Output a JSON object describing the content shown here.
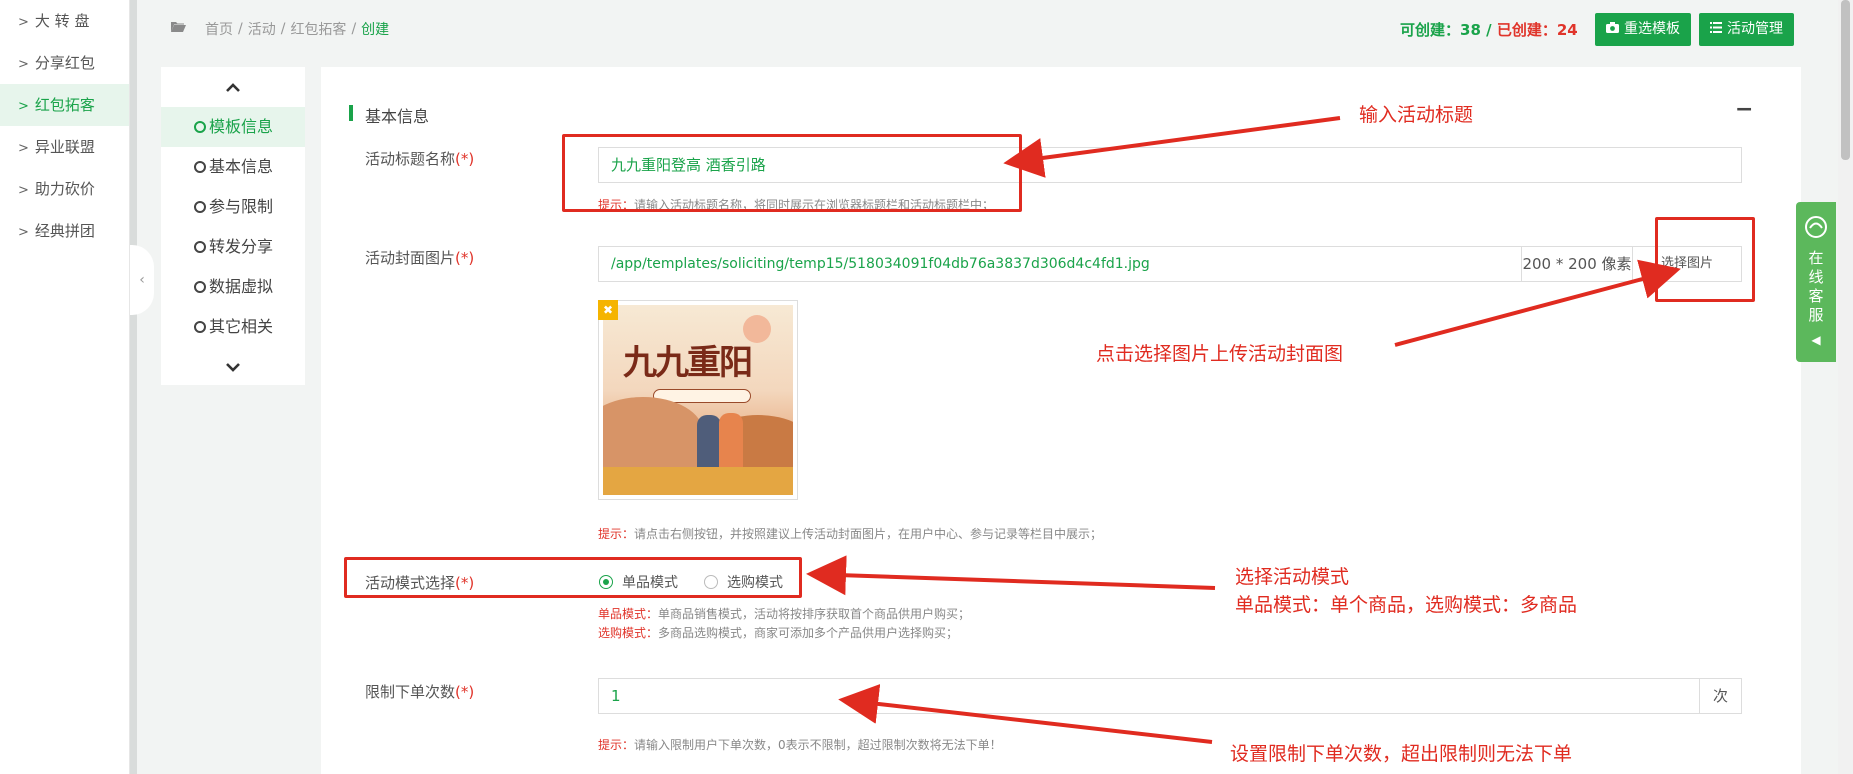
{
  "leftnav": {
    "items": [
      {
        "label": "大 转 盘",
        "active": false
      },
      {
        "label": "分享红包",
        "active": false
      },
      {
        "label": "红包拓客",
        "active": true
      },
      {
        "label": "异业联盟",
        "active": false
      },
      {
        "label": "助力砍价",
        "active": false
      },
      {
        "label": "经典拼团",
        "active": false
      }
    ],
    "chevron": ">",
    "collapse": "‹"
  },
  "breadcrumb": {
    "home": "首页",
    "sep": "/",
    "level2": "活动",
    "level3": "红包拓客",
    "current": "创建"
  },
  "counts": {
    "can_create_label": "可创建：",
    "can_create": "38",
    "slash": " / ",
    "created_label": "已创建：",
    "created": "24"
  },
  "toolbar": {
    "reselect_label": "重选模板",
    "manage_label": "活动管理"
  },
  "steps": {
    "up": "⌃",
    "down": "⌄",
    "items": [
      "模板信息",
      "基本信息",
      "参与限制",
      "转发分享",
      "数据虚拟",
      "其它相关"
    ],
    "active_index": 0
  },
  "section": {
    "title": "基本信息",
    "collapse": "−"
  },
  "form": {
    "title": {
      "label": "活动标题名称",
      "req": "(*)",
      "value": "九九重阳登高 酒香引路",
      "hint_key": "提示：",
      "hint": "请输入活动标题名称，将同时展示在浏览器标题栏和活动标题栏中；"
    },
    "cover": {
      "label": "活动封面图片",
      "req": "(*)",
      "value": "/app/templates/soliciting/temp15/518034091f04db76a3837d306d4c4fd1.jpg",
      "size_addon": "200 * 200 像素",
      "select_button": "选择图片",
      "hint_key": "提示：",
      "hint": "请点击右侧按钮，并按照建议上传活动封面图片，在用户中心、参与记录等栏目中展示；",
      "preview_title": "九九重阳",
      "remove": "✖"
    },
    "mode": {
      "label": "活动模式选择",
      "req": "(*)",
      "options": [
        "单品模式",
        "选购模式"
      ],
      "selected": 0,
      "hint1_key": "单品模式：",
      "hint1": "单商品销售模式，活动将按排序获取首个商品供用户购买；",
      "hint2_key": "选购模式：",
      "hint2": "多商品选购模式，商家可添加多个产品供用户选择购买；"
    },
    "limit": {
      "label": "限制下单次数",
      "req": "(*)",
      "value": "1",
      "unit": "次",
      "hint_key": "提示：",
      "hint": "请输入限制用户下单次数，0表示不限制，超过限制次数将无法下单！"
    }
  },
  "annotations": {
    "a1": "输入活动标题",
    "a2": "点击选择图片上传活动封面图",
    "a3_line1": "选择活动模式",
    "a3_line2": "单品模式：单个商品，选购模式：多商品",
    "a4": "设置限制下单次数，超出限制则无法下单"
  },
  "customer_service": {
    "label": "在线客服",
    "icon": "headset-icon",
    "collapse": "◀"
  },
  "colors": {
    "primary": "#1aa34a",
    "annotation": "#e02b20",
    "required": "#e0342a"
  }
}
